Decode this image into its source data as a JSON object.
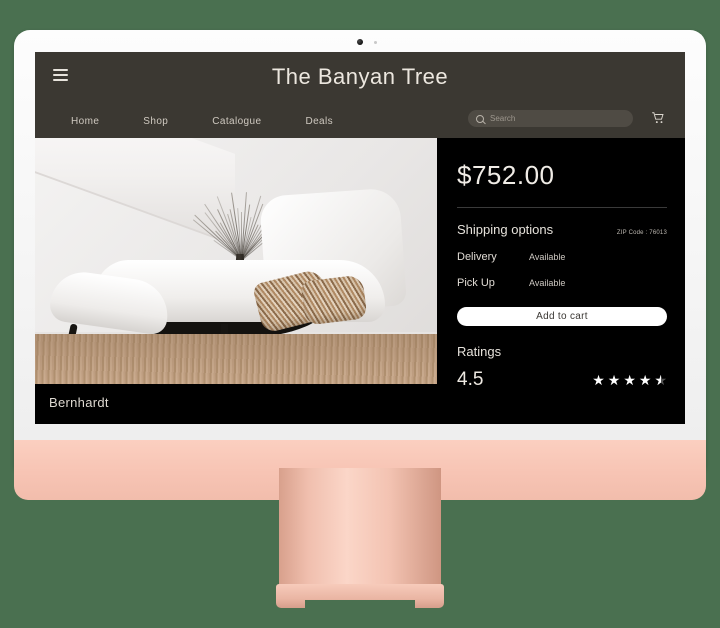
{
  "colors": {
    "background": "#4a7050",
    "bezel": "#fbfbfb",
    "chin": "#f7c4b4",
    "header": "#3b3832",
    "panel": "#000000",
    "accent_button": "#ffffff"
  },
  "device": {
    "camera_icon": "camera-dot",
    "led_icon": "status-led"
  },
  "header": {
    "menu_icon": "hamburger-icon",
    "title": "The Banyan Tree",
    "cart_icon": "shopping-cart-icon"
  },
  "nav": {
    "items": [
      {
        "label": "Home"
      },
      {
        "label": "Shop"
      },
      {
        "label": "Catalogue"
      },
      {
        "label": "Deals"
      }
    ]
  },
  "search": {
    "icon": "search-icon",
    "placeholder": "Search",
    "value": ""
  },
  "product": {
    "name": "Bernhardt",
    "image_alt": "white chaise lounge with striped pillows"
  },
  "detail": {
    "price": "$752.00",
    "shipping_title": "Shipping options",
    "zip_code": "ZIP Code : 76013",
    "options": [
      {
        "label": "Delivery",
        "value": "Available"
      },
      {
        "label": "Pick Up",
        "value": "Available"
      }
    ],
    "add_to_cart_label": "Add to cart",
    "ratings_title": "Ratings",
    "rating_value": "4.5",
    "stars_filled": 4,
    "stars_half": 1,
    "stars_total": 5
  }
}
